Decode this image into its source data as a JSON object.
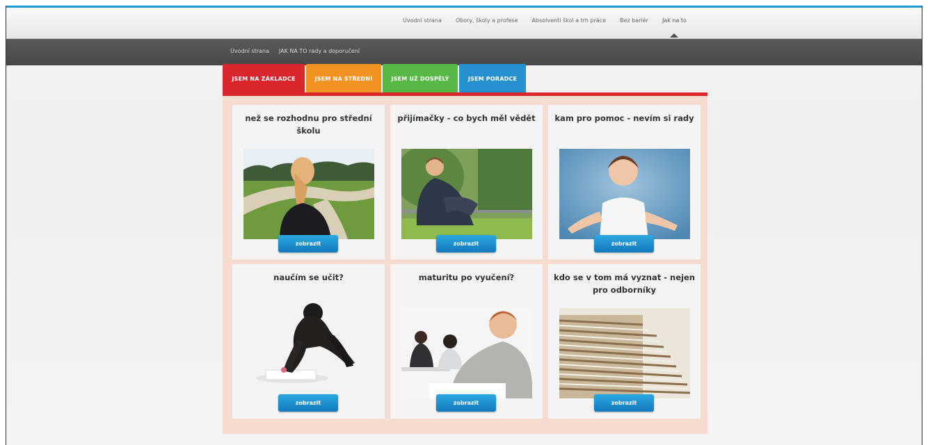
{
  "topnav": {
    "items": [
      "Úvodní strana",
      "Obory, školy a profese",
      "Absolventi škol a trh práce",
      "Bez bariér",
      "Jak na to"
    ]
  },
  "breadcrumb": [
    "Úvodní strana",
    "JAK NA TO rady a doporučení"
  ],
  "tabs": [
    {
      "label": "JSEM NA ZÁKLADCE",
      "color": "#d9252b"
    },
    {
      "label": "JSEM NA STŘEDNÍ",
      "color": "#f29220"
    },
    {
      "label": "JSEM UŽ DOSPĚLÝ",
      "color": "#57b845"
    },
    {
      "label": "JSEM PORADCE",
      "color": "#2591cf"
    }
  ],
  "cards": [
    {
      "title": "než se rozhodnu pro střední školu",
      "button": "zobrazit"
    },
    {
      "title": "přijímačky - co bych měl vědět",
      "button": "zobrazit"
    },
    {
      "title": "kam pro pomoc - nevím si rady",
      "button": "zobrazit"
    },
    {
      "title": "naučím se učit?",
      "button": "zobrazit"
    },
    {
      "title": "maturitu po vyučení?",
      "button": "zobrazit"
    },
    {
      "title": "kdo se v tom má vyznat - nejen pro odborníky",
      "button": "zobrazit"
    }
  ]
}
